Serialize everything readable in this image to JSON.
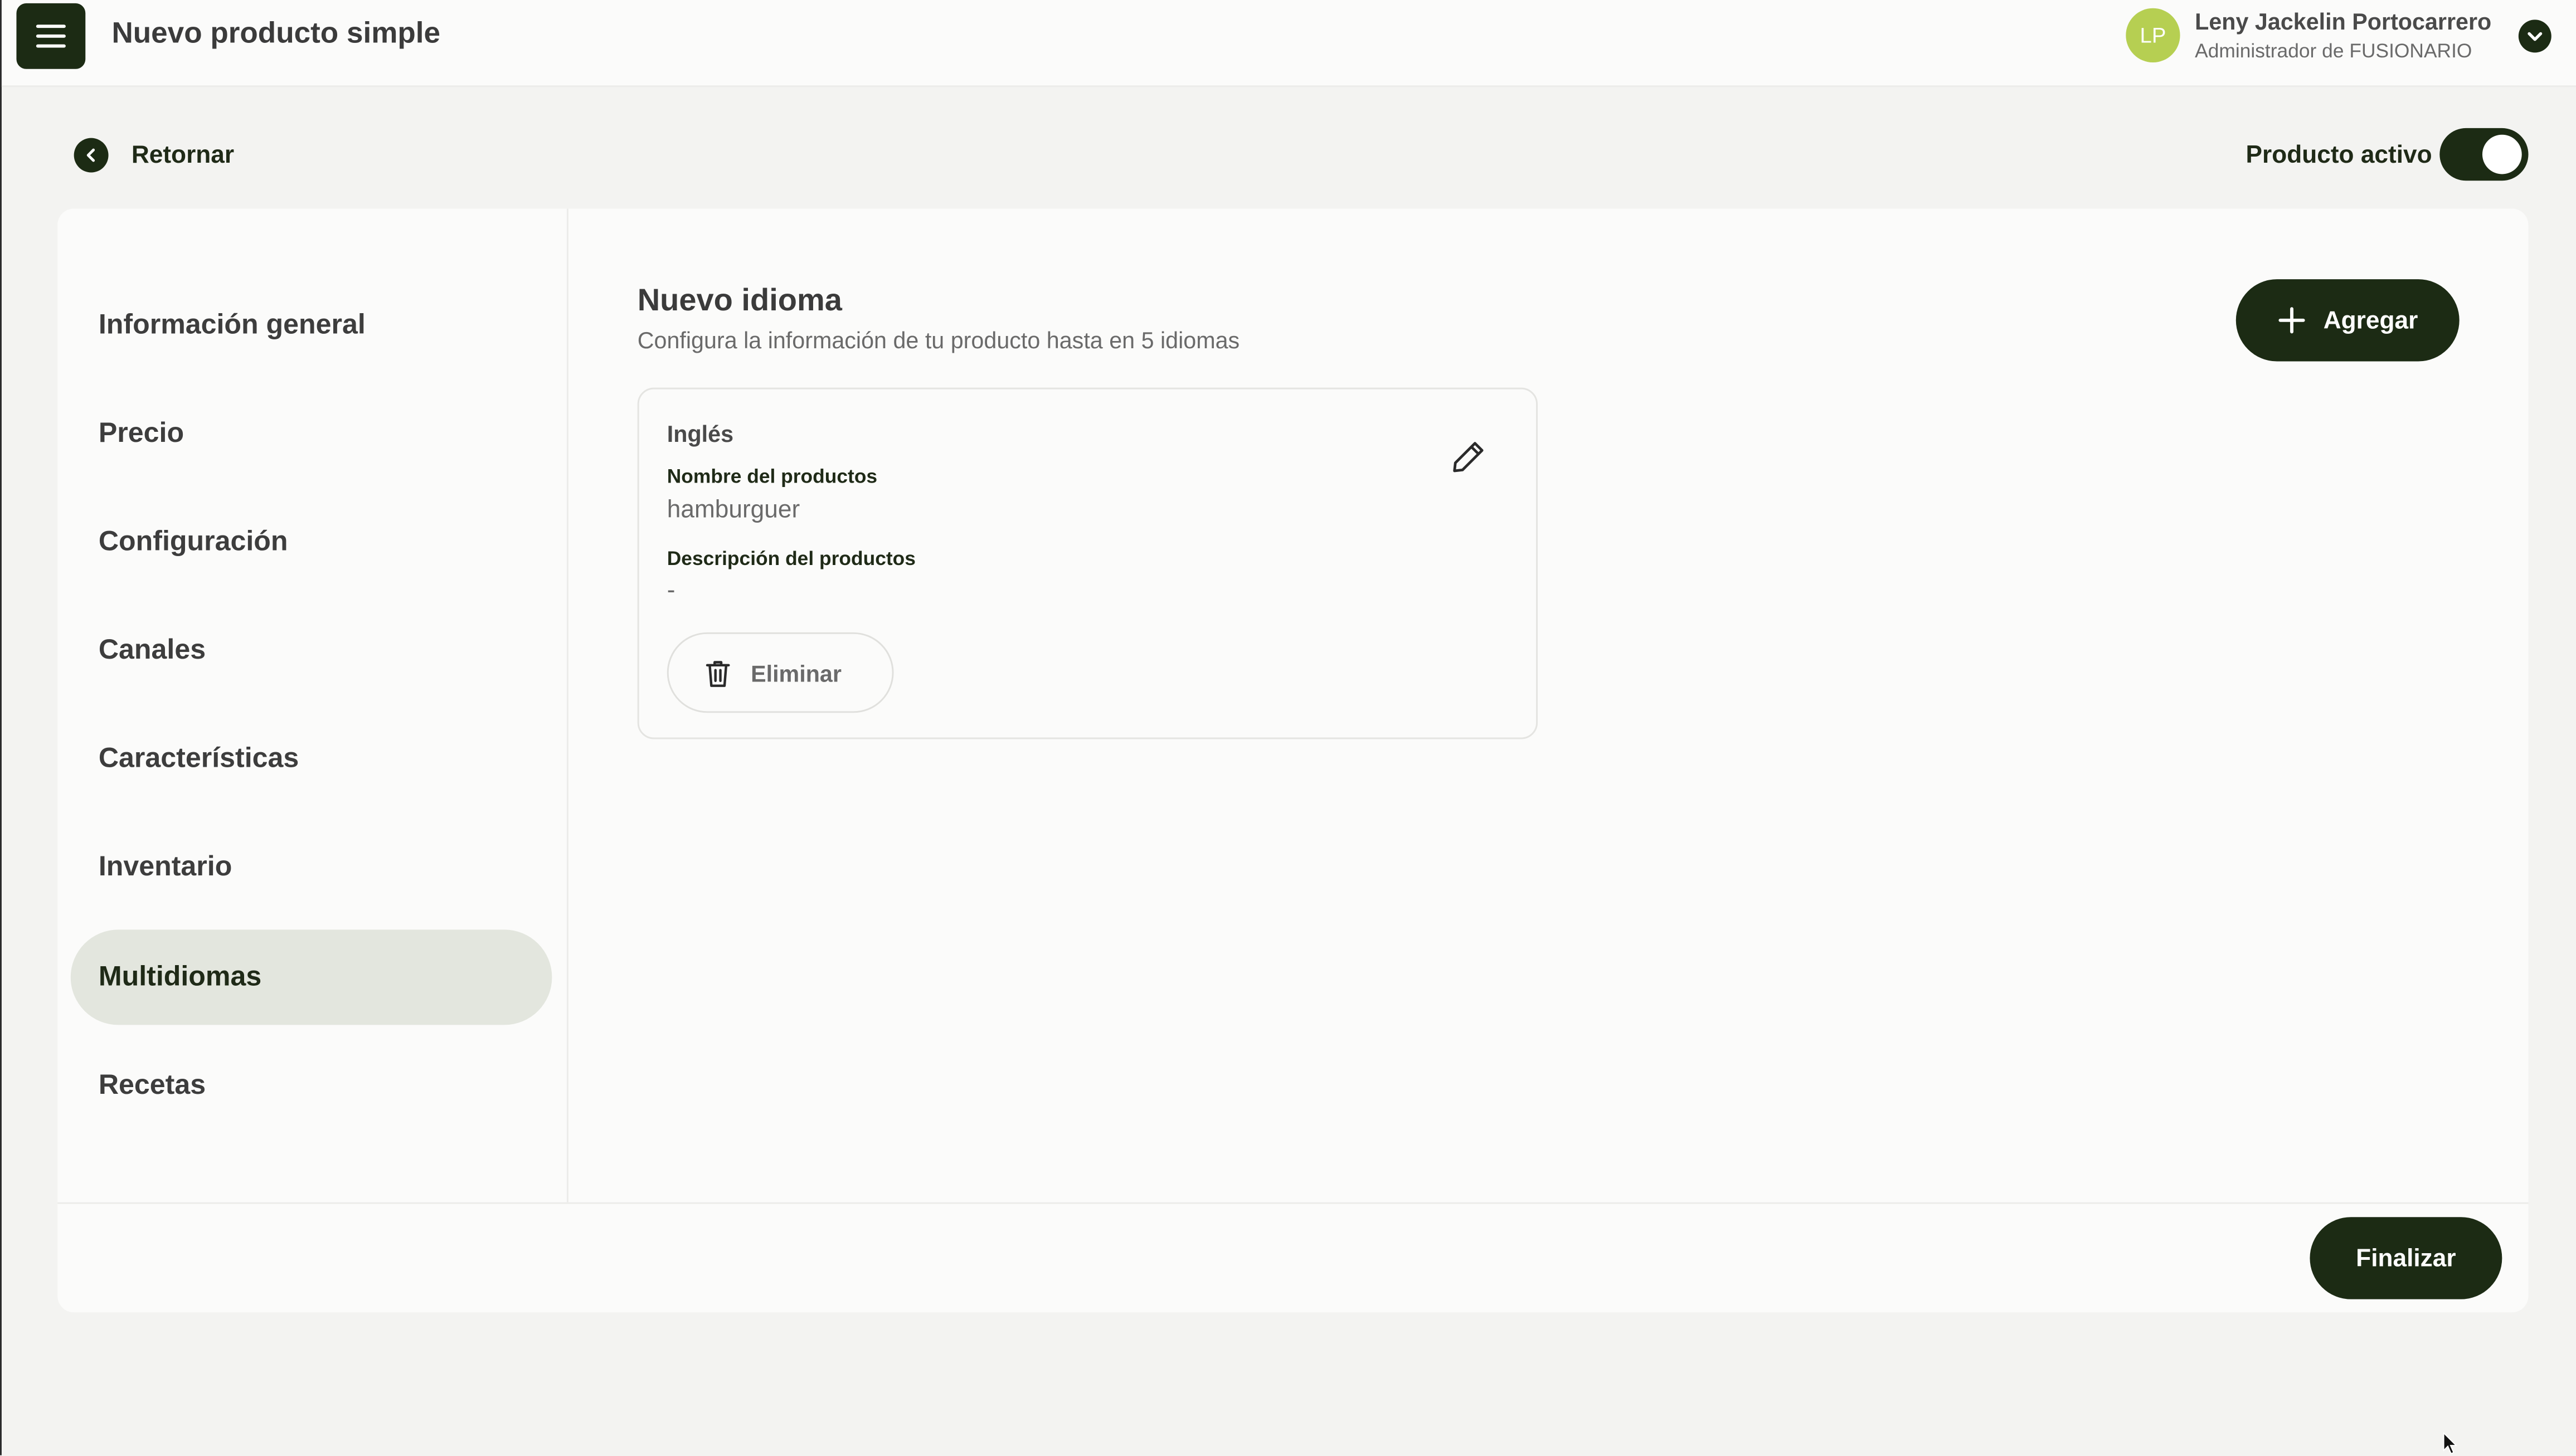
{
  "header": {
    "title": "Nuevo producto simple",
    "user": {
      "initials": "LP",
      "name": "Leny Jackelin Portocarrero",
      "role": "Administrador de FUSIONARIO"
    }
  },
  "toolbar": {
    "back_label": "Retornar",
    "active_label": "Producto activo",
    "active_on": true
  },
  "sidebar": {
    "items": [
      {
        "label": "Información general",
        "active": false
      },
      {
        "label": "Precio",
        "active": false
      },
      {
        "label": "Configuración",
        "active": false
      },
      {
        "label": "Canales",
        "active": false
      },
      {
        "label": "Características",
        "active": false
      },
      {
        "label": "Inventario",
        "active": false
      },
      {
        "label": "Multidiomas",
        "active": true
      },
      {
        "label": "Recetas",
        "active": false
      }
    ]
  },
  "main": {
    "title": "Nuevo idioma",
    "subtitle": "Configura la información de tu producto hasta en 5 idiomas",
    "add_label": "Agregar",
    "languages": [
      {
        "name": "Inglés",
        "name_label": "Nombre del productos",
        "name_value": "hamburguer",
        "description_label": "Descripción del productos",
        "description_value": "-",
        "delete_label": "Eliminar"
      }
    ]
  },
  "footer": {
    "finish_label": "Finalizar"
  },
  "colors": {
    "primary": "#1c2b14",
    "active_item_bg": "#e3e6de",
    "avatar": "#b6cf52",
    "page_bg": "#f3f3f1",
    "card_bg": "#fbfbfa"
  },
  "icons": [
    "hamburger-menu-icon",
    "chevron-down-icon",
    "chevron-left-icon",
    "plus-icon",
    "pencil-icon",
    "trash-icon",
    "mouse-cursor-icon"
  ]
}
